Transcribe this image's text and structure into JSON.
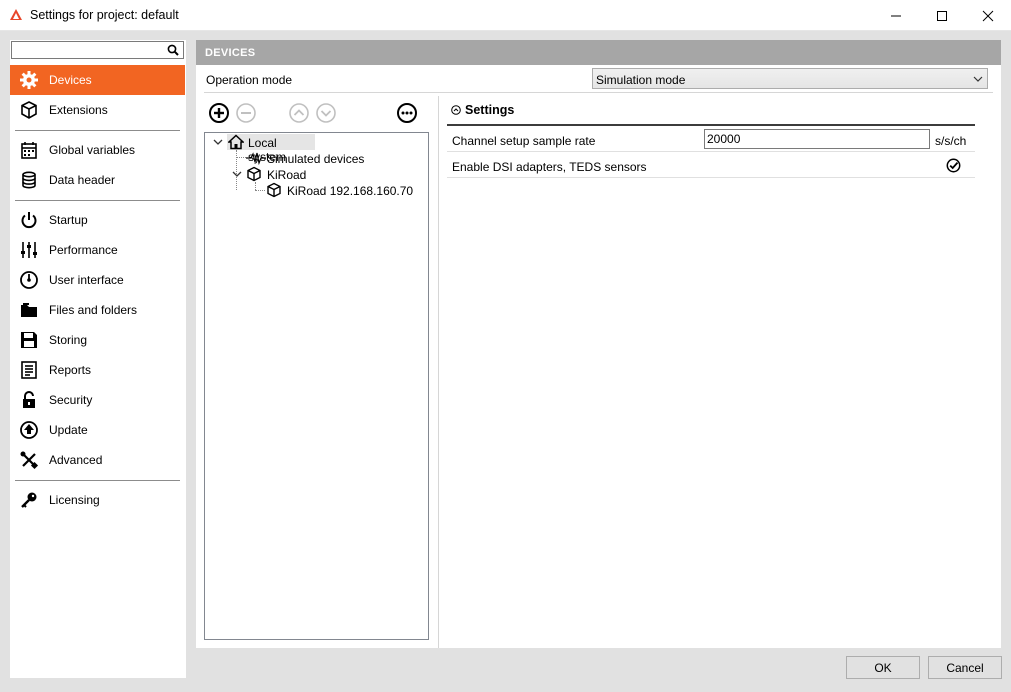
{
  "window": {
    "title": "Settings for project: default",
    "accent": "#f26522"
  },
  "search": {
    "value": "",
    "placeholder": ""
  },
  "sidebar": {
    "items": [
      {
        "label": "Devices",
        "icon": "gear-icon",
        "active": true
      },
      {
        "label": "Extensions",
        "icon": "cube-icon"
      },
      {
        "label": "Global variables",
        "icon": "calendar-icon"
      },
      {
        "label": "Data header",
        "icon": "database-icon"
      },
      {
        "label": "Startup",
        "icon": "power-icon"
      },
      {
        "label": "Performance",
        "icon": "sliders-icon"
      },
      {
        "label": "User interface",
        "icon": "gauge-icon"
      },
      {
        "label": "Files and folders",
        "icon": "folder-icon"
      },
      {
        "label": "Storing",
        "icon": "save-icon"
      },
      {
        "label": "Reports",
        "icon": "document-icon"
      },
      {
        "label": "Security",
        "icon": "lock-icon"
      },
      {
        "label": "Update",
        "icon": "update-icon"
      },
      {
        "label": "Advanced",
        "icon": "tools-icon"
      },
      {
        "label": "Licensing",
        "icon": "key-icon"
      }
    ]
  },
  "main": {
    "section_title": "DEVICES",
    "operation_mode_label": "Operation mode",
    "operation_mode_value": "Simulation mode",
    "tree": {
      "root": "Local system",
      "simulated": "Simulated devices",
      "kiroad": "KiRoad",
      "kiroad_child": "KiRoad 192.168.160.70"
    },
    "settings": {
      "title": "Settings",
      "rows": [
        {
          "label": "Channel setup sample rate",
          "value": "20000",
          "unit": "s/s/ch"
        },
        {
          "label": "Enable DSI adapters, TEDS sensors",
          "checked": true
        }
      ]
    }
  },
  "footer": {
    "ok_label": "OK",
    "cancel_label": "Cancel"
  }
}
